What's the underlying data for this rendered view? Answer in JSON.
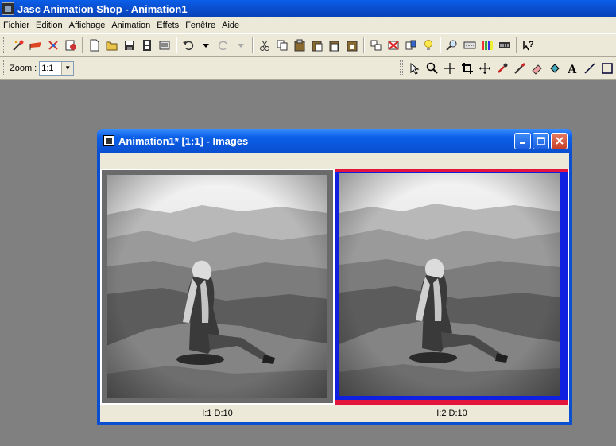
{
  "app": {
    "title": "Jasc Animation Shop - Animation1"
  },
  "menu": [
    "Fichier",
    "Edition",
    "Affichage",
    "Animation",
    "Effets",
    "Fenêtre",
    "Aide"
  ],
  "toolbar2": {
    "zoom_label": "Zoom :",
    "zoom_value": "1:1"
  },
  "child_window": {
    "title": "Animation1* [1:1] - Images"
  },
  "frames": [
    {
      "status": "I:1   D:10",
      "selected": false
    },
    {
      "status": "I:2   D:10",
      "selected": true
    }
  ],
  "colors": {
    "titlebar": "#0a4fd0",
    "selection_outer": "#e3153d",
    "selection_inner": "#1020e0",
    "workspace": "#808080"
  }
}
